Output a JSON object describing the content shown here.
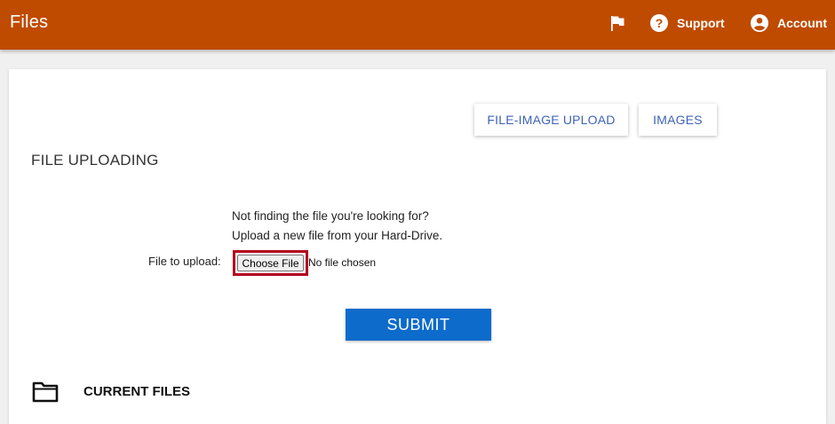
{
  "appbar": {
    "title": "Files",
    "support_label": "Support",
    "account_label": "Account",
    "icons": [
      "flag-icon",
      "help-circle-icon",
      "account-circle-icon"
    ]
  },
  "tabs": {
    "file_image_upload": "FILE-IMAGE UPLOAD",
    "images": "IMAGES"
  },
  "upload": {
    "section_title": "FILE UPLOADING",
    "hint_line1": "Not finding the file you're looking for?",
    "hint_line2": "Upload a new file from your Hard-Drive.",
    "file_label": "File to upload:",
    "choose_button": "Choose File",
    "no_file_text": "No file chosen",
    "submit_label": "SUBMIT"
  },
  "current_files": {
    "heading": "CURRENT FILES",
    "icon": "folder-icon"
  },
  "colors": {
    "appbar": "#bf4b00",
    "link_button_text": "#3f63b8",
    "submit": "#0d6bcb",
    "highlight_border": "#b3001e"
  }
}
